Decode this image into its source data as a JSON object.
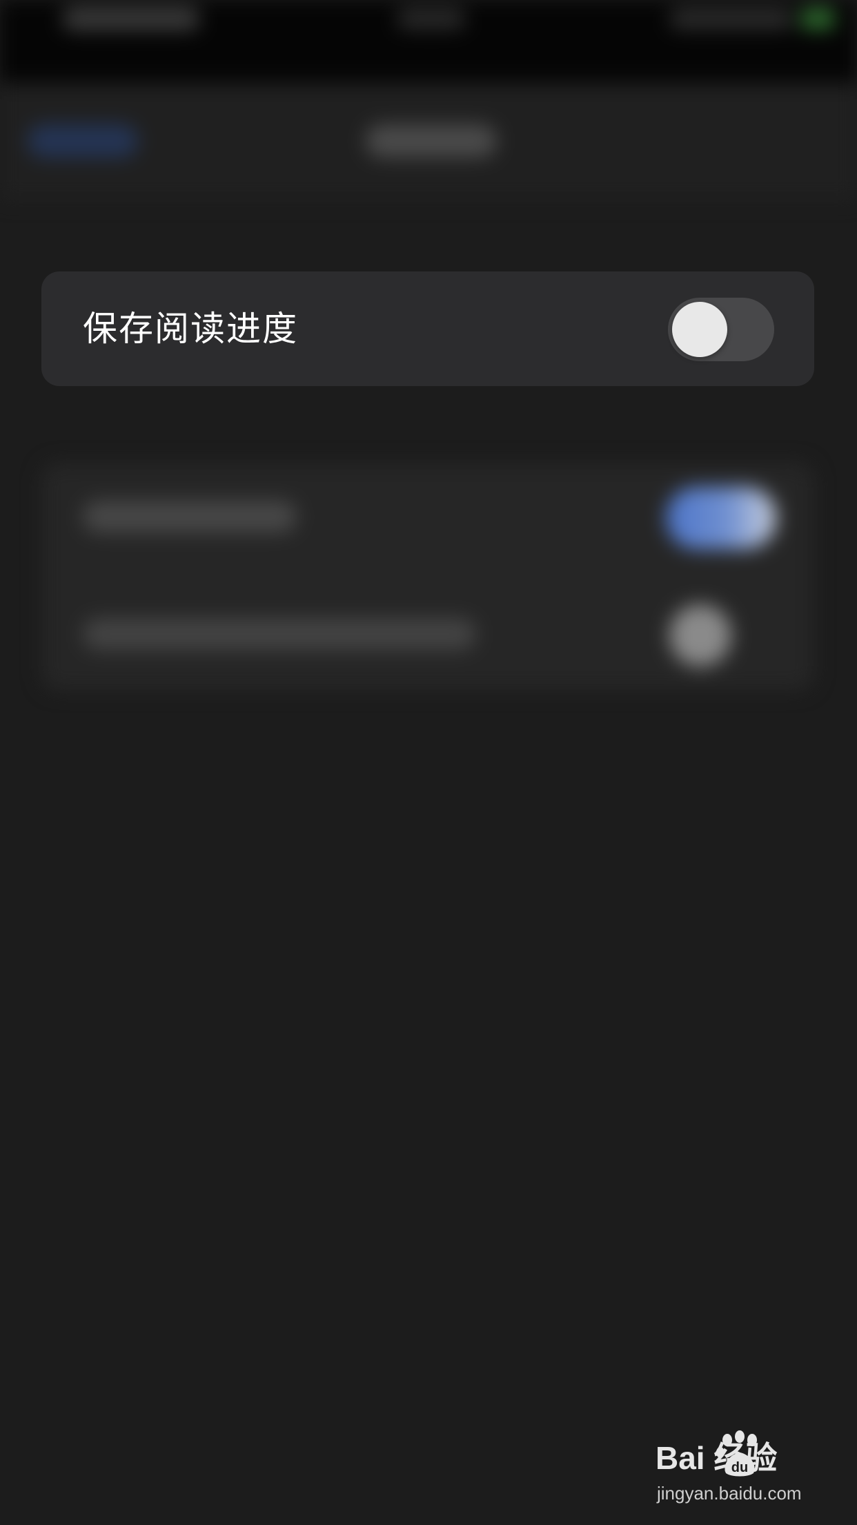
{
  "setting": {
    "label": "保存阅读进度",
    "toggle_state": "off"
  },
  "watermark": {
    "brand": "Bai  经验",
    "url": "jingyan.baidu.com"
  },
  "colors": {
    "background": "#1c1c1c",
    "card": "#2c2c2e",
    "toggle_off_track": "#48484a",
    "toggle_knob": "#e8e8e8",
    "blurred_accent": "#4c74c8"
  }
}
